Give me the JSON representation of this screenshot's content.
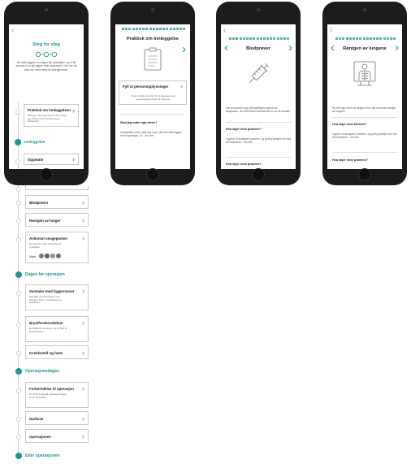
{
  "steps_overview": {
    "title": "Steg for steg",
    "intro": "Du skal legges inn dagen før operasjon og vil bli skrevet ut ut på dagen etter operasjon. Her har du tosa om hvert steg du skal gjennom.",
    "step1": {
      "title": "Praktisk om innleggelsen",
      "sub": "Skal jeg møte opp alene? Hvor lenge jeg må ha med? Hvordan jeg å forberede?"
    },
    "phases": [
      "Innleggelse",
      "Dagen før operasjon",
      "Operasjonsdagen",
      "Etter operasjonen"
    ],
    "items": [
      {
        "title": "Oppmøte"
      },
      {
        "title": "Blodprøver"
      },
      {
        "title": "Røntgen av lunger"
      },
      {
        "title": "Ankomst sengeposten",
        "sub": "Her skal du være møtt/rettet av sykepleier.",
        "avatars_label": "Møte"
      },
      {
        "title": "Samtaler med fagpersoner",
        "sub": "Samtaler og informasjon med kirurgen, fysio, anestesilege og sykepleier."
      },
      {
        "title": "Brystforeberedelser",
        "sub": "Et tidspunkt forutsetter og en liten til forberedelsen."
      },
      {
        "title": "Kveldsstell og faste"
      },
      {
        "title": "Forberedelse til operasjon",
        "sub": "Du vil bli forberedt operasjonsdagen av en sykepleier."
      },
      {
        "title": "Narkose"
      },
      {
        "title": "Operasjonen"
      }
    ]
  },
  "praktisk": {
    "title": "Praktisk om innleggelse",
    "card_title": "Fyll ut personopplysninger",
    "card_text": "Det er viktig at du har fylt ut skjemaet med personopplysninger før ankomst.",
    "question": "Skal jeg møte opp alene?",
    "answer": "Vi anbefaler at du møtt seg noen når man skal legges inn til operasjon. Er... les mer"
  },
  "blodprover": {
    "title": "Blodprøver",
    "text": "Før du kommer opp på avdelingen skal du ta blodprøver, du vil bli sett til laboratoriet en av de ansatte.",
    "q1": "Hva skjer med prøvene?",
    "a1": "Legene vil analysere prøvene, og gi deg beskjed om hva de innebærer... les mer",
    "q2": "Hva skjer med prøvene?"
  },
  "rontgen": {
    "title": "Røntgen av lungene",
    "text": "Du blir fulgt videre til røntgen hvor det vil bli tatt røntgen av lungene.",
    "q1": "Hva skjer med bildene?",
    "a1": "Legene vil analysere prøvene, og gi deg beskjed om hva de innebærer... les mer",
    "q2": "Hva skjer med prøvene?"
  },
  "colors": {
    "accent": "#1a9a8e",
    "phone": "#1c1c1c"
  },
  "icons": [
    "chevron-left-icon",
    "chevron-right-icon",
    "clipboard-icon",
    "syringe-icon",
    "xray-icon"
  ]
}
